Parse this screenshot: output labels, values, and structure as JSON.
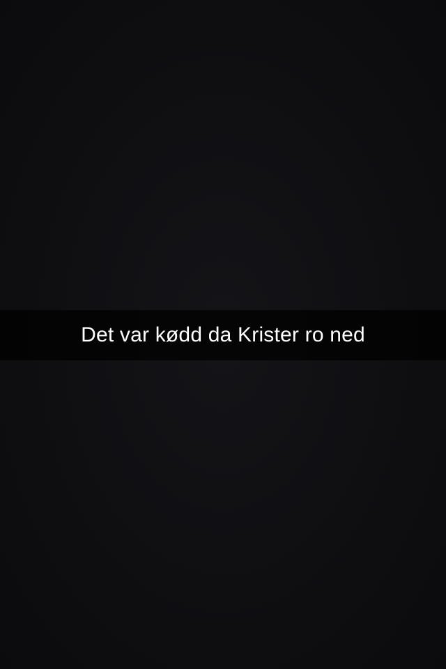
{
  "snap": {
    "caption": "Det var kødd da Krister ro ned"
  },
  "colors": {
    "background": "#0d0d10",
    "caption_bar": "rgba(0,0,0,0.72)",
    "caption_text": "#ffffff"
  }
}
